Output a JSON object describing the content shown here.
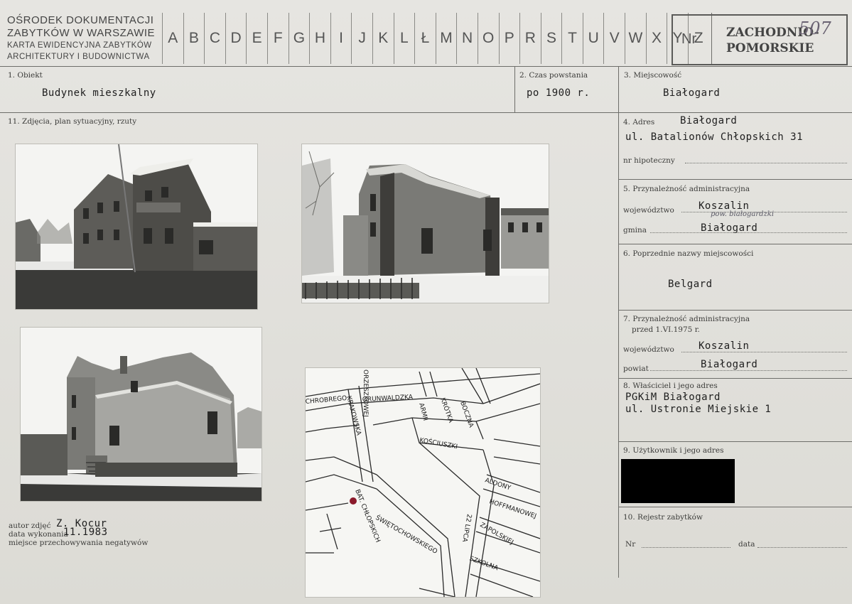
{
  "header": {
    "institution_line1": "OŚRODEK DOKUMENTACJI",
    "institution_line2": "ZABYTKÓW W WARSZAWIE",
    "institution_line3": "KARTA EWIDENCYJNA ZABYTKÓW",
    "institution_line4": "ARCHITEKTURY I BUDOWNICTWA",
    "letters": [
      "A",
      "B",
      "C",
      "D",
      "E",
      "F",
      "G",
      "H",
      "I",
      "J",
      "K",
      "L",
      "Ł",
      "M",
      "N",
      "O",
      "P",
      "R",
      "S",
      "T",
      "U",
      "V",
      "W",
      "X",
      "Y",
      "Z"
    ],
    "nr_label": "Nr",
    "region_line1": "ZACHODNIO-",
    "region_line2": "POMORSKIE",
    "handwritten_number": "507"
  },
  "fields": {
    "obiekt_label": "1. Obiekt",
    "obiekt_value": "Budynek mieszkalny",
    "czas_label": "2. Czas powstania",
    "czas_value": "po 1900 r.",
    "miejscowosc_label": "3. Miejscowość",
    "miejscowosc_value": "Białogard",
    "zdjecia_label": "11. Zdjęcia, plan sytuacyjny, rzuty",
    "adres_label": "4. Adres",
    "adres_value_line1": "Białogard",
    "adres_value_line2": "ul. Batalionów Chłopskich 31",
    "nr_hipoteczny_label": "nr hipoteczny",
    "przynaleznosc_label": "5. Przynależność administracyjna",
    "wojewodztwo_label": "województwo",
    "wojewodztwo_value": "Koszalin",
    "wojewodztwo_handnote": "pow. białogardzki",
    "gmina_label": "gmina",
    "gmina_value": "Białogard",
    "poprzednie_label": "6. Poprzednie nazwy miejscowości",
    "poprzednie_value": "Belgard",
    "przynaleznosc2_label_line1": "7. Przynależność administracyjna",
    "przynaleznosc2_label_line2": "przed 1.VI.1975 r.",
    "wojewodztwo2_label": "województwo",
    "wojewodztwo2_value": "Koszalin",
    "powiat_label": "powiat",
    "powiat_value": "Białogard",
    "wlasciciel_label": "8. Właściciel i jego adres",
    "wlasciciel_value_line1": "PGKiM Białogard",
    "wlasciciel_value_line2": "ul. Ustronie Miejskie 1",
    "uzytkownik_label": "9. Użytkownik i jego adres",
    "rejestr_label": "10. Rejestr zabytków",
    "rejestr_nr_label": "Nr",
    "rejestr_data_label": "data"
  },
  "photo_credits": {
    "autor_label": "autor zdjęć",
    "autor_value": "Z. Kocur",
    "data_label": "data wykonania",
    "data_value": "11.1983",
    "miejsce_label": "miejsce przechowywania negatywów"
  },
  "map": {
    "street_labels": [
      "GRUNWALDZKA",
      "ALDONY",
      "HOFFMANOWEJ",
      "ZAPOLSKIEJ",
      "KOŚCIUSZKI",
      "BOCZNA",
      "KRÓTKA",
      "ŚWIĘTOCHOWSKIEGO",
      "BAT. CHŁOPSKICH",
      "22 LIPCA",
      "ORZESZKOWEJ",
      "CHROBREGO",
      "KRAKOWSKA",
      "ARMII",
      "SZKOLNA"
    ],
    "marker_color": "#8b1a2b"
  }
}
